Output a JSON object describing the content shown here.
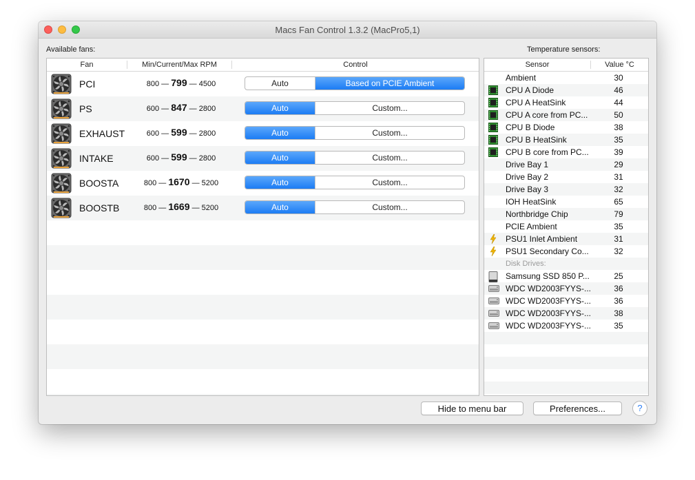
{
  "window": {
    "title": "Macs Fan Control 1.3.2 (MacPro5,1)"
  },
  "labels": {
    "available_fans": "Available fans:",
    "temperature_sensors": "Temperature sensors:"
  },
  "fans_table": {
    "columns": [
      "Fan",
      "Min/Current/Max RPM",
      "Control"
    ],
    "rows": [
      {
        "name": "PCI",
        "min": "800",
        "current": "799",
        "max": "4500",
        "left": "Auto",
        "right": "Based on PCIE Ambient",
        "mode": "custom"
      },
      {
        "name": "PS",
        "min": "600",
        "current": "847",
        "max": "2800",
        "left": "Auto",
        "right": "Custom...",
        "mode": "auto"
      },
      {
        "name": "EXHAUST",
        "min": "600",
        "current": "599",
        "max": "2800",
        "left": "Auto",
        "right": "Custom...",
        "mode": "auto"
      },
      {
        "name": "INTAKE",
        "min": "600",
        "current": "599",
        "max": "2800",
        "left": "Auto",
        "right": "Custom...",
        "mode": "auto"
      },
      {
        "name": "BOOSTA",
        "min": "800",
        "current": "1670",
        "max": "5200",
        "left": "Auto",
        "right": "Custom...",
        "mode": "auto"
      },
      {
        "name": "BOOSTB",
        "min": "800",
        "current": "1669",
        "max": "5200",
        "left": "Auto",
        "right": "Custom...",
        "mode": "auto"
      }
    ],
    "separator": "—"
  },
  "sensors_table": {
    "columns": [
      "Sensor",
      "Value °C"
    ],
    "rows": [
      {
        "name": "Ambient",
        "value": "30",
        "icon": "none"
      },
      {
        "name": "CPU A Diode",
        "value": "46",
        "icon": "chip-icon"
      },
      {
        "name": "CPU A HeatSink",
        "value": "44",
        "icon": "chip-icon"
      },
      {
        "name": "CPU A core from PC...",
        "value": "50",
        "icon": "chip-icon"
      },
      {
        "name": "CPU B Diode",
        "value": "38",
        "icon": "chip-icon"
      },
      {
        "name": "CPU B HeatSink",
        "value": "35",
        "icon": "chip-icon"
      },
      {
        "name": "CPU B core from PC...",
        "value": "39",
        "icon": "chip-icon"
      },
      {
        "name": "Drive Bay 1",
        "value": "29",
        "icon": "none"
      },
      {
        "name": "Drive Bay 2",
        "value": "31",
        "icon": "none"
      },
      {
        "name": "Drive Bay 3",
        "value": "32",
        "icon": "none"
      },
      {
        "name": "IOH HeatSink",
        "value": "65",
        "icon": "none"
      },
      {
        "name": "Northbridge Chip",
        "value": "79",
        "icon": "none"
      },
      {
        "name": "PCIE Ambient",
        "value": "35",
        "icon": "none"
      },
      {
        "name": "PSU1 Inlet Ambient",
        "value": "31",
        "icon": "bolt-icon"
      },
      {
        "name": "PSU1 Secondary Co...",
        "value": "32",
        "icon": "bolt-icon"
      },
      {
        "group": "Disk Drives:"
      },
      {
        "name": "Samsung SSD 850 P...",
        "value": "25",
        "icon": "ssd-icon"
      },
      {
        "name": "WDC WD2003FYYS-...",
        "value": "36",
        "icon": "hdd-icon"
      },
      {
        "name": "WDC WD2003FYYS-...",
        "value": "36",
        "icon": "hdd-icon"
      },
      {
        "name": "WDC WD2003FYYS-...",
        "value": "38",
        "icon": "hdd-icon"
      },
      {
        "name": "WDC WD2003FYYS-...",
        "value": "35",
        "icon": "hdd-icon"
      }
    ]
  },
  "buttons": {
    "hide_to_menu_bar": "Hide to menu bar",
    "preferences": "Preferences...",
    "help": "?"
  },
  "colors": {
    "accent": "#1c7cf4",
    "chip_green": "#2e8b2e",
    "bolt_yellow": "#f0b400"
  }
}
